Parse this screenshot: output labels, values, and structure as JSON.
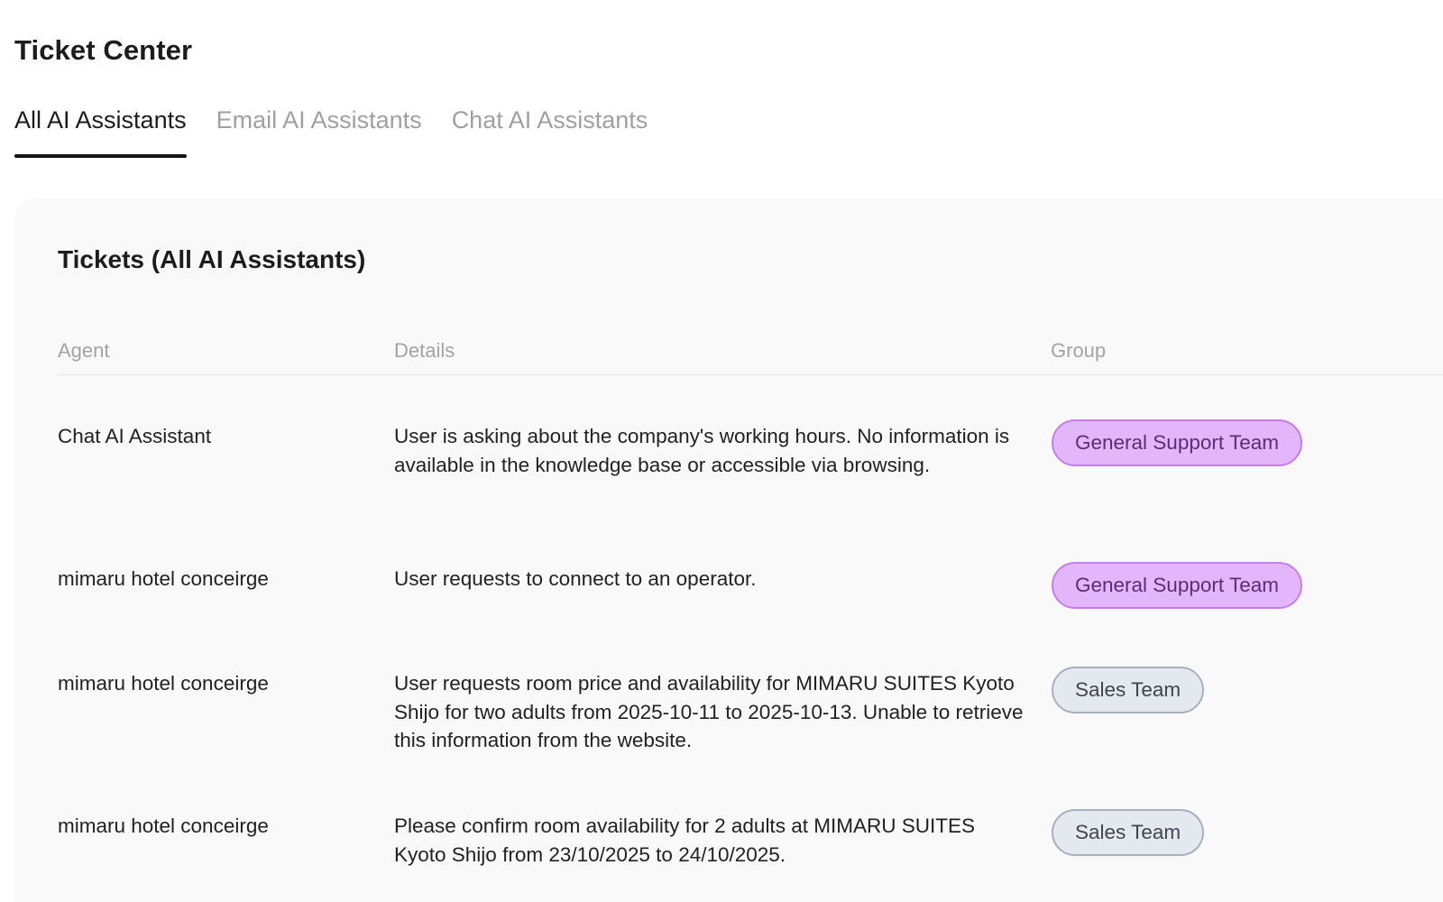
{
  "header": {
    "title": "Ticket Center"
  },
  "tabs": [
    {
      "label": "All AI Assistants",
      "active": true
    },
    {
      "label": "Email AI Assistants",
      "active": false
    },
    {
      "label": "Chat AI Assistants",
      "active": false
    }
  ],
  "tickets": {
    "title": "Tickets (All AI Assistants)",
    "columns": {
      "agent": "Agent",
      "details": "Details",
      "group": "Group"
    },
    "rows": [
      {
        "agent": "Chat AI Assistant",
        "details": "User is asking about the company's working hours. No information is available in the knowledge base or accessible via browsing.",
        "group": "General Support Team",
        "group_color": "#e3b6fb"
      },
      {
        "agent": "mimaru hotel conceirge",
        "details": "User requests to connect to an operator.",
        "group": "General Support Team",
        "group_color": "#e3b6fb"
      },
      {
        "agent": "mimaru hotel conceirge",
        "details": "User requests room price and availability for MIMARU SUITES Kyoto Shijo for two adults from 2025-10-11 to 2025-10-13. Unable to retrieve this information from the website.",
        "group": "Sales Team",
        "group_color": "#e4e8ef"
      },
      {
        "agent": "mimaru hotel conceirge",
        "details": "Please confirm room availability for 2 adults at MIMARU SUITES Kyoto Shijo from 23/10/2025 to 24/10/2025.",
        "group": "Sales Team",
        "group_color": "#e4e8ef"
      }
    ]
  },
  "colors": {
    "active_tab": "#1c1c1c",
    "inactive_tab": "#a0a0a0",
    "card_background": "#f9f9f9",
    "badge_purple": "#e3b6fb",
    "badge_gray": "#e4e8ef"
  }
}
